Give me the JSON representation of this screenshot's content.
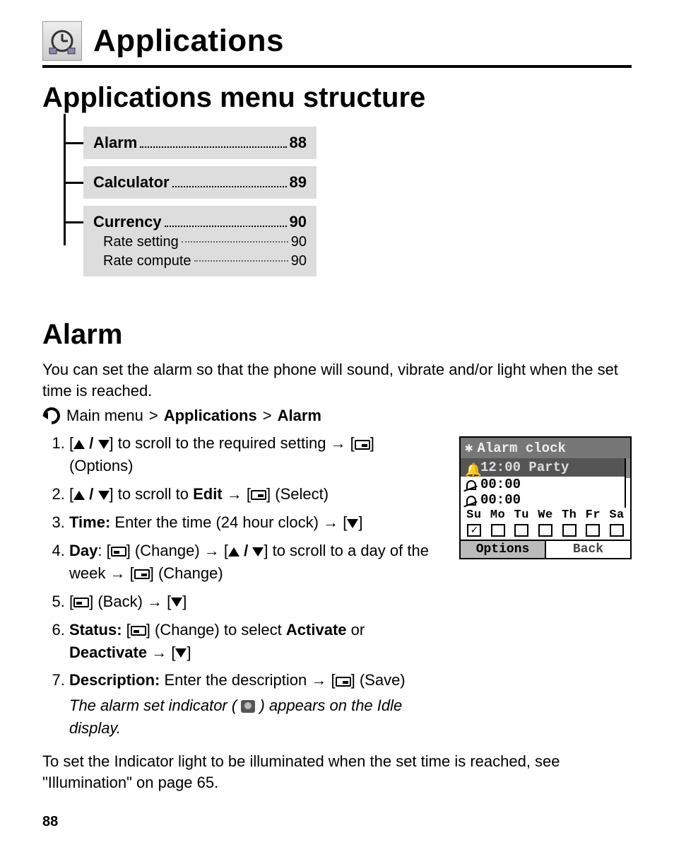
{
  "header": {
    "title": "Applications"
  },
  "section": {
    "title": "Applications menu structure"
  },
  "menu": [
    {
      "label": "Alarm",
      "page": "88",
      "subs": []
    },
    {
      "label": "Calculator",
      "page": "89",
      "subs": []
    },
    {
      "label": "Currency",
      "page": "90",
      "subs": [
        {
          "label": "Rate setting",
          "page": "90"
        },
        {
          "label": "Rate compute",
          "page": "90"
        }
      ]
    }
  ],
  "alarm": {
    "title": "Alarm",
    "intro": "You can set the alarm so that the phone will sound, vibrate and/or light when the set time is reached.",
    "breadcrumb": {
      "a": "Main menu",
      "b": "Applications",
      "c": "Alarm",
      "sep": ">"
    },
    "steps": {
      "s1a": "] to scroll to the required setting ",
      "options": "] (Options)",
      "s2a": "] to scroll to ",
      "edit": "Edit",
      "s2b": "] (Select)",
      "timeLabel": "Time:",
      "s3": " Enter the time (24 hour clock) ",
      "dayLabel": "Day",
      "s4a": "] (Change) ",
      "s4b": "] to scroll to a day of the week ",
      "s4c": "] (Change)",
      "s5a": "] (Back) ",
      "statusLabel": "Status:",
      "s6a": "] (Change) to select ",
      "activate": "Activate",
      "or": " or ",
      "deactivate": "Deactivate",
      "descLabel": "Description:",
      "s7a": " Enter the description ",
      "s7b": "] (Save)",
      "note1": "The alarm set indicator",
      "note2": "appears on the Idle display.",
      "footer": "To set the Indicator light to be illuminated when the set time is reached, see \"Illumination\" on page 65."
    }
  },
  "phoneScreen": {
    "title": "Alarm clock",
    "selected": "12:00 Party",
    "row2": "00:00",
    "row3": "00:00",
    "days": [
      "Su",
      "Mo",
      "Tu",
      "We",
      "Th",
      "Fr",
      "Sa"
    ],
    "checks": [
      true,
      false,
      false,
      false,
      false,
      false,
      false
    ],
    "softLeft": "Options",
    "softRight": "Back"
  },
  "pageNumber": "88"
}
